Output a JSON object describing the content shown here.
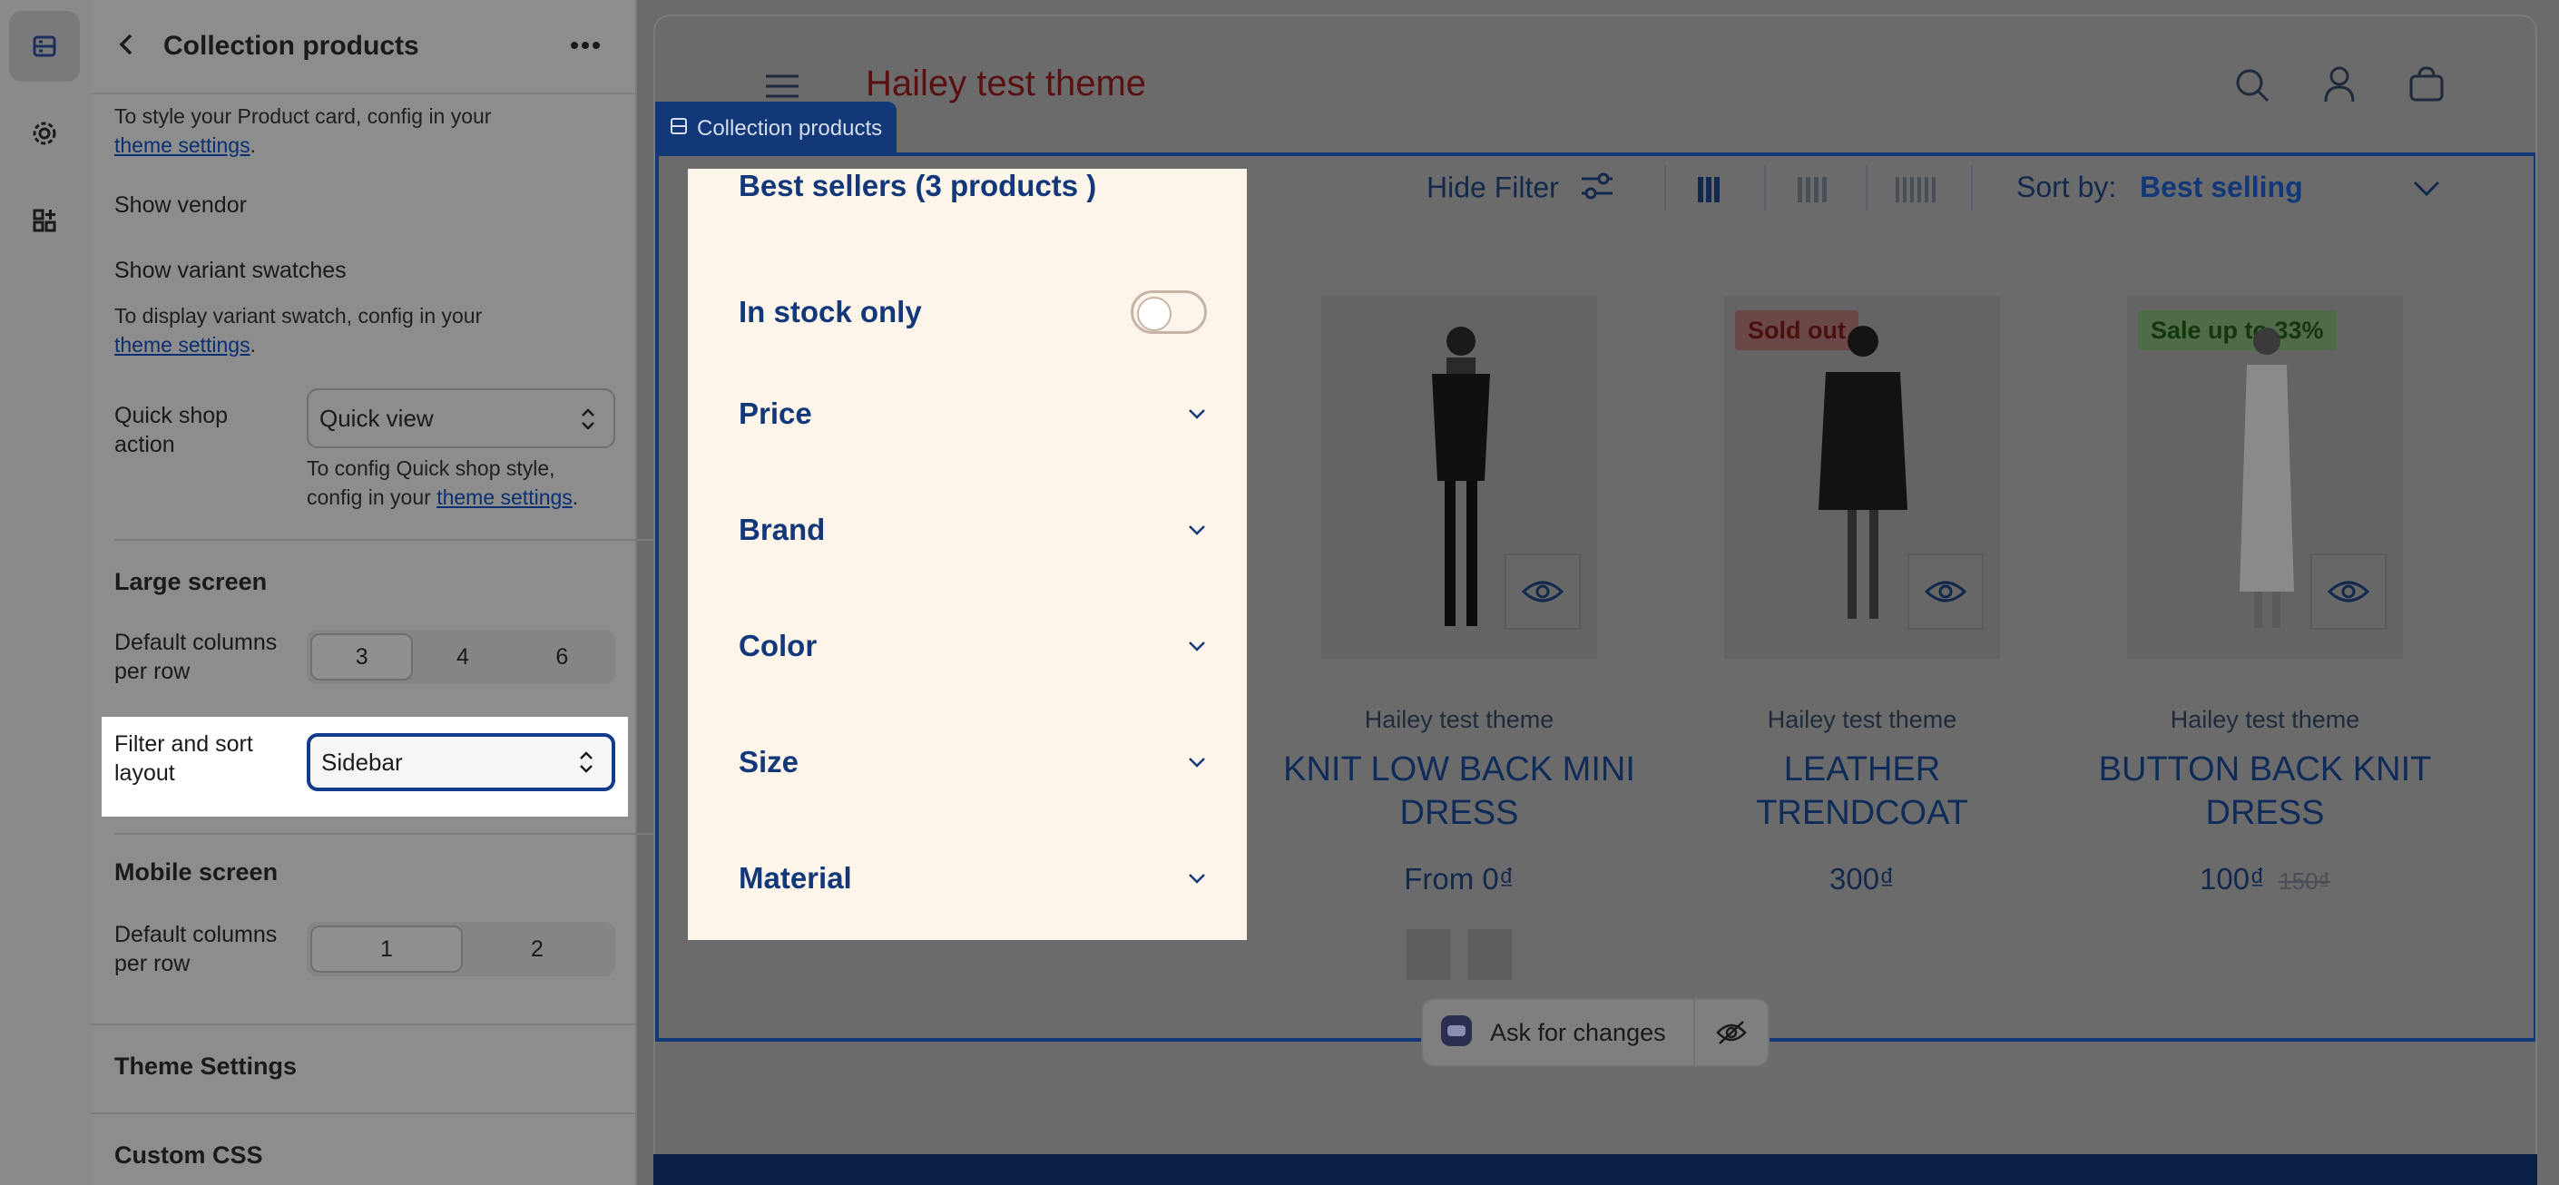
{
  "panel": {
    "title": "Collection products",
    "help_product_card_prefix": "To style your Product card, config in your",
    "theme_settings_link": "theme settings",
    "show_vendor_label": "Show vendor",
    "show_vendor_on": true,
    "show_variant_swatches_label": "Show variant swatches",
    "show_variant_swatches_on": true,
    "help_variant_prefix": "To display variant swatch, config in your",
    "quick_shop_label_1": "Quick shop",
    "quick_shop_label_2": "action",
    "quick_shop_value": "Quick view",
    "help_quick_shop_1": "To config Quick shop style,",
    "help_quick_shop_2": "config in your",
    "large_screen_title": "Large screen",
    "default_columns_label_1": "Default columns",
    "default_columns_label_2": "per row",
    "large_columns": [
      "3",
      "4",
      "6"
    ],
    "large_columns_selected": "3",
    "filter_sort_label_1": "Filter and sort",
    "filter_sort_label_2": "layout",
    "filter_sort_value": "Sidebar",
    "mobile_screen_title": "Mobile screen",
    "mobile_columns": [
      "1",
      "2"
    ],
    "mobile_columns_selected": "1",
    "theme_settings_section": "Theme Settings",
    "custom_css_section": "Custom CSS"
  },
  "rail": {
    "icons": [
      "sections-icon",
      "gear-icon",
      "apps-icon"
    ]
  },
  "preview": {
    "store_title": "Hailey test theme",
    "section_chip": "Collection products",
    "hide_filter": "Hide Filter",
    "sort_by_label": "Sort by:",
    "sort_by_value": "Best selling",
    "filter": {
      "title": "Best sellers (3 products )",
      "in_stock": "In stock only",
      "groups": [
        "Price",
        "Brand",
        "Color",
        "Size",
        "Material"
      ]
    },
    "products": [
      {
        "vendor": "Hailey test theme",
        "name_1": "KNIT LOW BACK MINI",
        "name_2": "DRESS",
        "price": "From 0₫",
        "badge": ""
      },
      {
        "vendor": "Hailey test theme",
        "name_1": "LEATHER",
        "name_2": "TRENDCOAT",
        "price": "300₫",
        "badge": "Sold out"
      },
      {
        "vendor": "Hailey test theme",
        "name_1": "BUTTON BACK KNIT",
        "name_2": "DRESS",
        "price": "100₫",
        "compare_price": "150₫",
        "badge": "Sale up to 33%"
      }
    ],
    "ask_button": "Ask for changes"
  },
  "colors": {
    "accent": "#13387a",
    "store_title": "#5a1010",
    "filter_bg": "#fdf5ea",
    "sold_out_badge": "#6a4848",
    "sale_badge": "#4f6b47"
  }
}
